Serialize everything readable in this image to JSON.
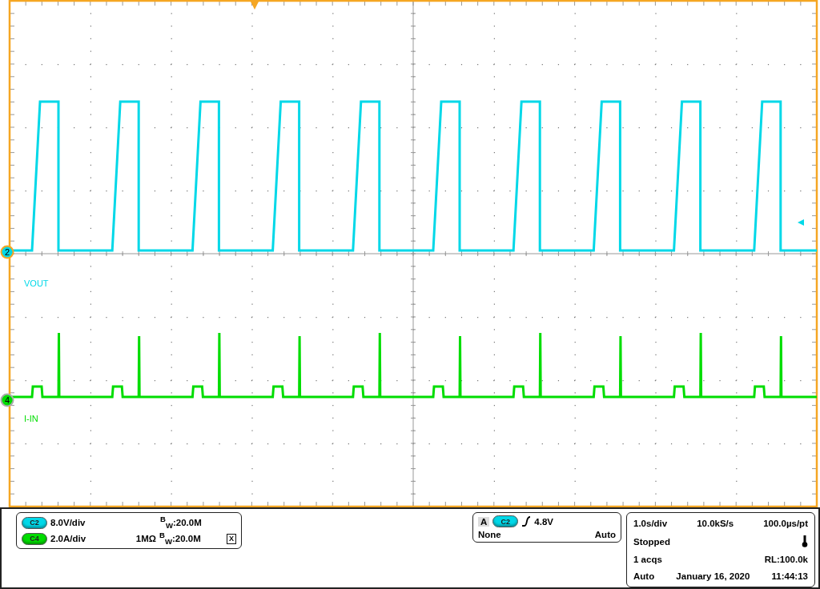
{
  "channels": [
    {
      "number": "2",
      "label": "VOUT",
      "color": "#00d8e8",
      "badge": "C2",
      "scale": "8.0V/div",
      "bandwidth": "$^{B}$$_{W}$:20.0M"
    },
    {
      "number": "4",
      "label": "I-IN",
      "color": "#00dd00",
      "badge": "C4",
      "scale": "2.0A/div",
      "impedance": "1MΩ",
      "bandwidth": "$^{B}$$_{W}$:20.0M",
      "tag": "X"
    }
  ],
  "trigger": {
    "mode_letter": "A",
    "badge": "C2",
    "level": "4.8V",
    "coupling": "None",
    "sweep": "Auto"
  },
  "timebase": {
    "scale": "1.0s/div",
    "sample_rate": "10.0kS/s",
    "resolution": "100.0µs/pt",
    "state": "Stopped",
    "acquisitions": "1 acqs",
    "record_length": "RL:100.0k",
    "acquisition_mode": "Auto",
    "date": "January 16, 2020",
    "time": "11:44:13"
  }
}
